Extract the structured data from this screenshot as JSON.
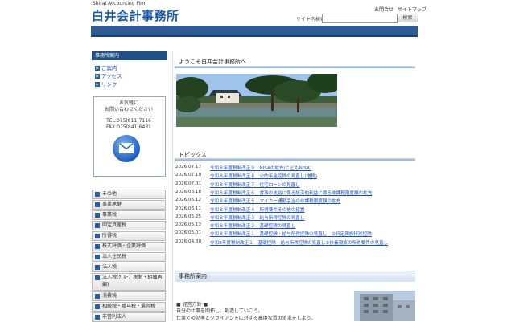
{
  "header": {
    "tagline": "Shirai Accounting Firm",
    "logo": "白井会計事務所",
    "links": [
      "お問合せ",
      "サイトマップ"
    ],
    "search_label": "サイト内検索",
    "search_value": "",
    "search_button": "検索"
  },
  "sidebar": {
    "title": "事務所案内",
    "links": [
      {
        "label": "ご案内"
      },
      {
        "label": "アクセス"
      },
      {
        "label": "リンク"
      }
    ],
    "contact_note": "お気軽に\nお問い合わせください",
    "tel": "TEL:075(811)7116",
    "fax": "FAX:075(841)6431",
    "categories": [
      "その他",
      "事業承継",
      "事業税",
      "固定資産税",
      "所得税",
      "株式評価・企業評価",
      "法人住民税",
      "法人税",
      "法人税(ｸﾞﾙｰﾌﾟ税制・組織再編)",
      "消費税",
      "相続税・贈与税・遺言税",
      "非営利法人"
    ]
  },
  "main": {
    "welcome": "ようこそ白井会計事務所へ",
    "topics_title": "トピックス",
    "topics": [
      {
        "date": "2026.07.17",
        "text": "令和８年度税制改正９　NISAの拡充(こどもNISA)"
      },
      {
        "date": "2026.07.10",
        "text": "令和８年度税制改正８　公的年金控除の見直し(増税)"
      },
      {
        "date": "2026.07.01",
        "text": "令和８年度税制改正７　住宅ローンの見直し"
      },
      {
        "date": "2026.06.18",
        "text": "令和８年度税制改正６　食事の支給に係る経済的利益に係る非課税限度額の拡充"
      },
      {
        "date": "2026.06.12",
        "text": "令和８年度税制改正５　マイカー通勤手当の非課税限度額の拡充"
      },
      {
        "date": "2026.06.11",
        "text": "令和８年度税制改正４　所得要件その他の措置"
      },
      {
        "date": "2026.05.25",
        "text": "令和８年度税制改正３　給与所得控除の見直し"
      },
      {
        "date": "2026.05.13",
        "text": "令和８年度税制改正２　基礎控除の見直し"
      },
      {
        "date": "2026.05.01",
        "text": "令和８年度税制改正１　基礎控除・給与所得控除の見直し　②特定親族特別控除"
      },
      {
        "date": "2026.04.30",
        "text": "令和8年度税制改正１　基礎控除・給与所得控除の見直し②扶養親族の所得要件の見直し"
      }
    ],
    "office_title": "事務所案内",
    "policy_head": "■ 経営方針 ■",
    "policy_lines": [
      "自分の仕事を開拓し、創造していこう。",
      "仕事での効率とクライアントに対する高度な質の追求をしよう。"
    ]
  },
  "colors": {
    "brand_blue": "#1a5aa8",
    "bar_blue": "#2d5b93",
    "link_blue": "#1a4fc4"
  }
}
